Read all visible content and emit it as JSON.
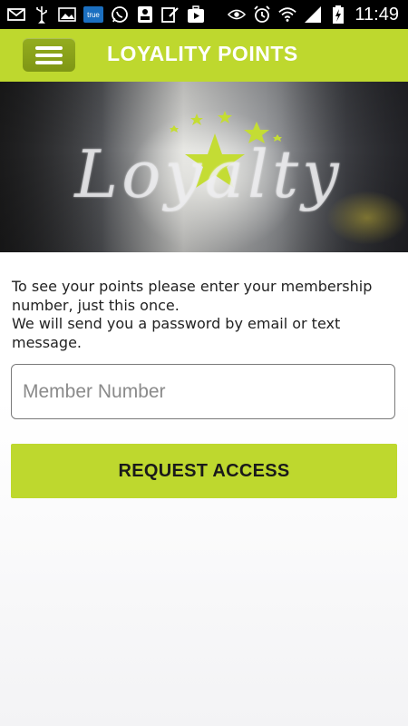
{
  "status_bar": {
    "time": "11:49",
    "left_icons": [
      "mail-icon",
      "usb-icon",
      "image-icon",
      "true-app-icon",
      "whatsapp-icon",
      "id-card-icon",
      "edit-icon",
      "play-store-icon"
    ],
    "right_icons": [
      "eye-icon",
      "alarm-icon",
      "wifi-icon",
      "signal-icon",
      "battery-charging-icon"
    ],
    "true_badge": "true"
  },
  "app_bar": {
    "title": "LOYALITY POINTS",
    "color": "#bed82e"
  },
  "banner": {
    "word": "Loyalty"
  },
  "content": {
    "instruction_line1": "To see your points please enter your membership number, just this once.",
    "instruction_line2": "We will send you a password by email or text message.",
    "member_input": {
      "value": "",
      "placeholder": "Member Number"
    },
    "request_button_label": "REQUEST ACCESS"
  }
}
